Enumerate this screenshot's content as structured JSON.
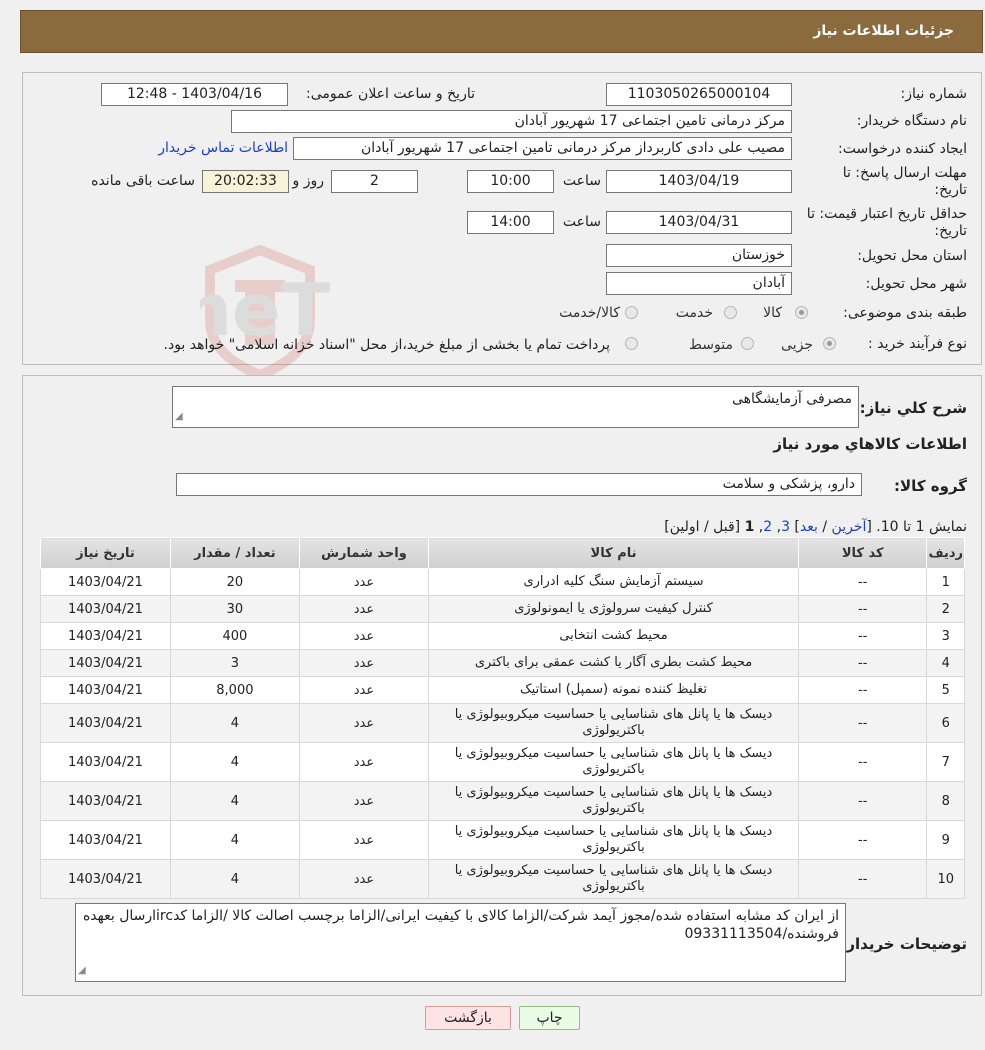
{
  "header": {
    "title": "جزئیات اطلاعات نیاز"
  },
  "form": {
    "need_number_label": "شماره نیاز:",
    "need_number": "1103050265000104",
    "announce_label": "تاریخ و ساعت اعلان عمومی:",
    "announce_value": "1403/04/16 - 12:48",
    "buyer_org_label": "نام دستگاه خریدار:",
    "buyer_org": "مرکز درمانی تامین اجتماعی 17 شهریور آبادان",
    "requester_label": "ایجاد کننده درخواست:",
    "requester": "مصیب علی دادی کاربرداز مرکز درمانی تامین اجتماعی 17 شهریور آبادان",
    "contact_link": "اطلاعات تماس خریدار",
    "deadline_label_1": "مهلت ارسال پاسخ: تا",
    "deadline_label_2": "تاریخ:",
    "deadline_date": "1403/04/19",
    "time_label": "ساعت",
    "deadline_time": "10:00",
    "days_value": "2",
    "days_label": "روز و",
    "remaining_time": "20:02:33",
    "remaining_label": "ساعت باقی مانده",
    "validity_label_1": "حداقل تاریخ اعتبار قیمت: تا",
    "validity_label_2": "تاریخ:",
    "validity_date": "1403/04/31",
    "validity_time_label": "ساعت",
    "validity_time": "14:00",
    "province_label": "استان محل تحویل:",
    "province": "خوزستان",
    "city_label": "شهر محل تحویل:",
    "city": "آبادان",
    "category_label": "طبقه بندی موضوعی:",
    "category_options": [
      "کالا",
      "خدمت",
      "کالا/خدمت"
    ],
    "process_label": "نوع فرآیند خرید :",
    "process_options": [
      "جزیی",
      "متوسط"
    ],
    "process_note": "پرداخت تمام یا بخشی از مبلغ خرید،از محل \"اسناد خزانه اسلامی\" خواهد بود."
  },
  "details": {
    "summary_label": "شرح کلي نياز:",
    "summary": "مصرفی آزمایشگاهی",
    "items_heading": "اطلاعات کالاهاي مورد نياز",
    "group_label": "گروه کالا:",
    "group_value": "دارو، پزشکی و سلامت",
    "pagination": {
      "prefix": "نمایش 1 تا 10.",
      "last": "آخرین",
      "next": "بعد",
      "p3": "3",
      "p2": "2",
      "p1": "1",
      "tail": "[قبل / اولین]"
    },
    "columns": [
      "ردیف",
      "کد کالا",
      "نام کالا",
      "واحد شمارش",
      "تعداد / مقدار",
      "تاریخ نیاز"
    ],
    "rows": [
      [
        "1",
        "--",
        "سیستم آزمایش سنگ کلیه ادراری",
        "عدد",
        "20",
        "1403/04/21"
      ],
      [
        "2",
        "--",
        "کنترل کیفیت سرولوژی یا ایمونولوژی",
        "عدد",
        "30",
        "1403/04/21"
      ],
      [
        "3",
        "--",
        "محیط کشت انتخابی",
        "عدد",
        "400",
        "1403/04/21"
      ],
      [
        "4",
        "--",
        "محیط کشت بطری آگار یا کشت عمقی برای باکتری",
        "عدد",
        "3",
        "1403/04/21"
      ],
      [
        "5",
        "--",
        "تغلیظ کننده نمونه (سمپل) استاتیک",
        "عدد",
        "8,000",
        "1403/04/21"
      ],
      [
        "6",
        "--",
        "دیسک ها یا پانل های شناسایی یا حساسیت میکروبیولوژی یا باکتریولوژی",
        "عدد",
        "4",
        "1403/04/21"
      ],
      [
        "7",
        "--",
        "دیسک ها یا پانل های شناسایی یا حساسیت میکروبیولوژی یا باکتریولوژی",
        "عدد",
        "4",
        "1403/04/21"
      ],
      [
        "8",
        "--",
        "دیسک ها یا پانل های شناسایی یا حساسیت میکروبیولوژی یا باکتریولوژی",
        "عدد",
        "4",
        "1403/04/21"
      ],
      [
        "9",
        "--",
        "دیسک ها یا پانل های شناسایی یا حساسیت میکروبیولوژی یا باکتریولوژی",
        "عدد",
        "4",
        "1403/04/21"
      ],
      [
        "10",
        "--",
        "دیسک ها یا پانل های شناسایی یا حساسیت میکروبیولوژی یا باکتریولوژی",
        "عدد",
        "4",
        "1403/04/21"
      ]
    ],
    "buyer_notes_label": "توضیحات خریدار:",
    "buyer_notes": "از ایران کد مشابه استفاده شده/مجوز آیمد شرکت/الزاما کالای با کیفیت ایرانی/الزاما برچسب اصالت کالا /الزاما کدircارسال بعهده فروشنده/09331113504"
  },
  "buttons": {
    "print": "چاپ",
    "back": "بازگشت"
  },
  "watermark": {
    "text": "AriaTender.neT"
  }
}
